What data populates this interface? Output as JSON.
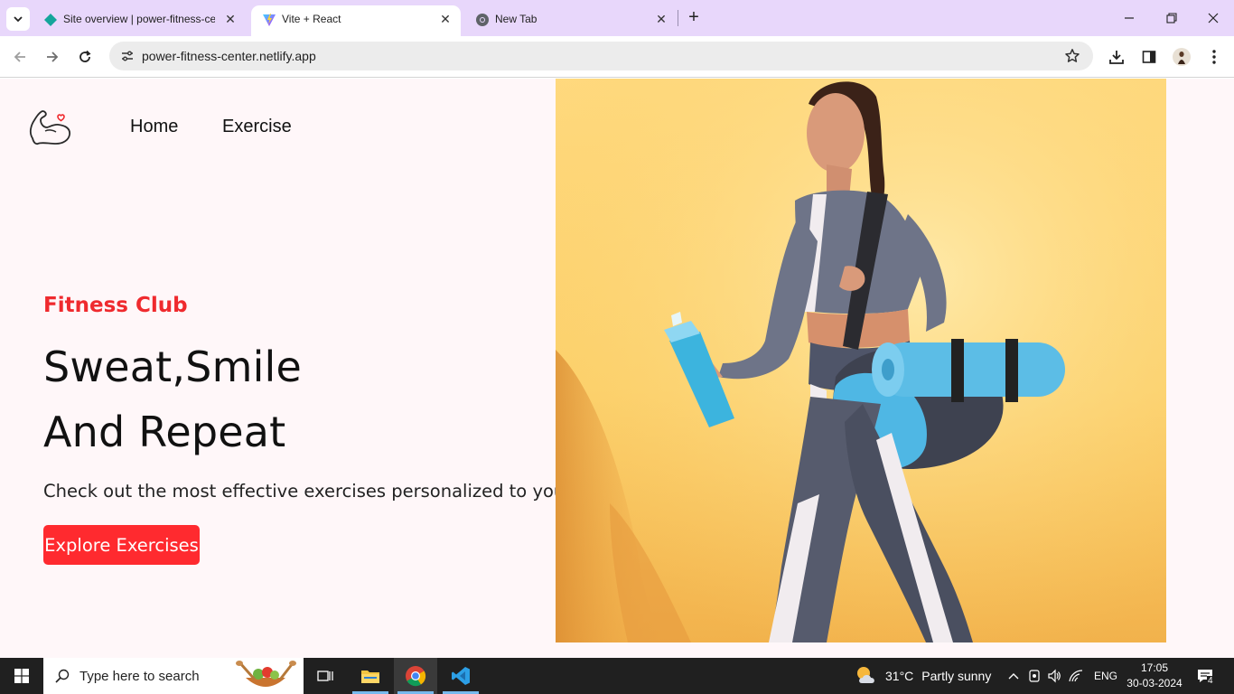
{
  "browser": {
    "tabs": [
      {
        "title": "Site overview | power-fitness-center",
        "icon": "netlify-diamond-icon",
        "active": false
      },
      {
        "title": "Vite + React",
        "icon": "vite-icon",
        "active": true
      },
      {
        "title": "New Tab",
        "icon": "chrome-icon",
        "active": false
      }
    ],
    "url": "power-fitness-center.netlify.app"
  },
  "page": {
    "nav": [
      "Home",
      "Exercise"
    ],
    "eyebrow": "Fitness Club",
    "headline_line1": "Sweat,Smile",
    "headline_line2": "And Repeat",
    "subtitle": "Check out the most effective exercises personalized to you",
    "cta": "Explore Exercises",
    "accent_color": "#ff2a2f"
  },
  "taskbar": {
    "search_placeholder": "Type here to search",
    "weather_temp": "31°C",
    "weather_text": "Partly sunny",
    "language": "ENG",
    "time": "17:05",
    "date": "30-03-2024",
    "notification_count": "4"
  }
}
